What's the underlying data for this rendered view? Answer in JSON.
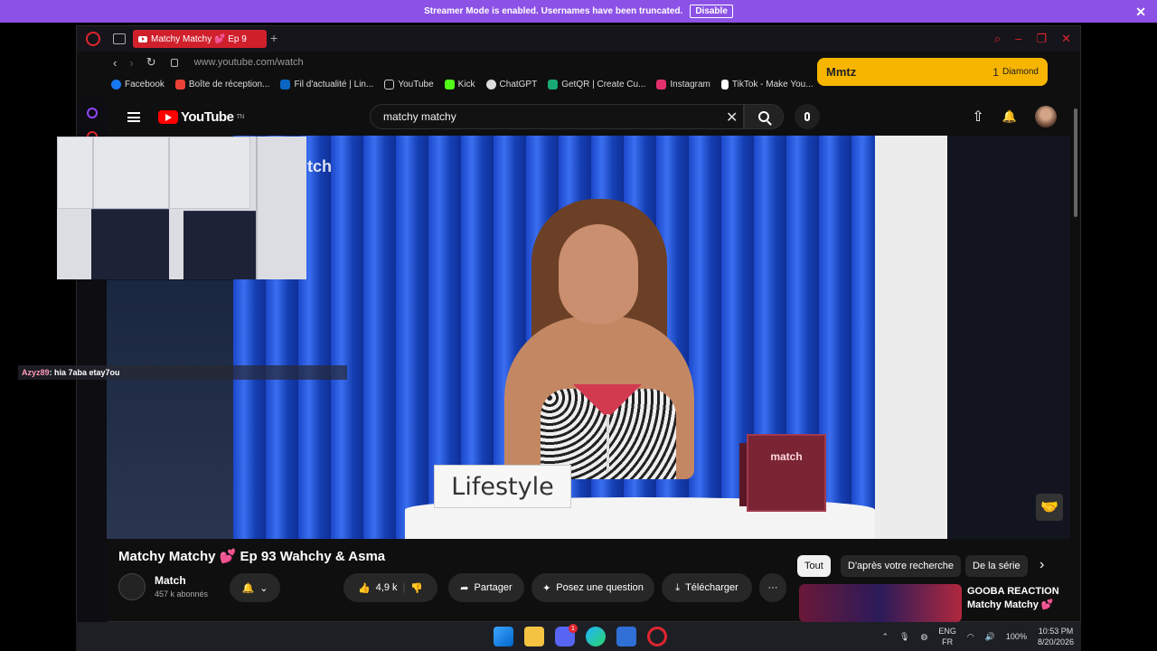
{
  "banner": {
    "message": "Streamer Mode is enabled. Usernames have been truncated.",
    "disable_label": "Disable",
    "close": "✕"
  },
  "browser": {
    "tab_title": "Matchy Matchy 💕 Ep 9",
    "new_tab": "+",
    "url": "www.youtube.com/watch",
    "nav_back": "‹",
    "nav_forward": "›",
    "reload": "↻",
    "bookmarks": [
      {
        "label": "Facebook",
        "color": "#1877f2"
      },
      {
        "label": "Boîte de réception...",
        "color": "#ea4335"
      },
      {
        "label": "Fil d'actualité | Lin...",
        "color": "#0a66c2"
      },
      {
        "label": "YouTube",
        "color": "#cccccc"
      },
      {
        "label": "Kick",
        "color": "#53fc18"
      },
      {
        "label": "ChatGPT",
        "color": "#dddddd"
      },
      {
        "label": "GetQR | Create Cu...",
        "color": "#19a974"
      },
      {
        "label": "Instagram",
        "color": "#e1306c"
      },
      {
        "label": "TikTok - Make You...",
        "color": "#ffffff"
      }
    ]
  },
  "youtube": {
    "logo_text": "YouTube",
    "logo_sup": "TN",
    "search_value": "matchy matchy",
    "clear": "✕",
    "upload": "⇧",
    "bell": "🔔"
  },
  "video": {
    "watermark": "tch",
    "sign_text": "Lifestyle",
    "box_text": "match",
    "title": "Matchy Matchy 💕 Ep 93 Wahchy & Asma",
    "channel": "Match",
    "subscribers": "457 k abonnés",
    "likes": "4,9 k",
    "share": "Partager",
    "ask": "Posez une question",
    "download": "Télécharger",
    "more": "···"
  },
  "chips": {
    "items": [
      "Tout",
      "D'après votre recherche",
      "De la série"
    ],
    "next": "›"
  },
  "suggestion": {
    "line1": "GOOBA REACTION",
    "line2": "Matchy Matchy 💕"
  },
  "overlay": {
    "chat_user": "Azyz89",
    "chat_msg": " : hia 7aba etay7ou",
    "donor_name": "Mmtz",
    "donor_amount": "1",
    "donor_unit": "Diamond"
  },
  "taskbar": {
    "lang_top": "ENG",
    "lang_bottom": "FR",
    "battery": "100%",
    "time": "10:53 PM",
    "date": "8/20/2026",
    "badge": "1"
  },
  "colors": {
    "banner": "#8c52e6",
    "opera_red": "#e0252f",
    "donor": "#f7b500"
  }
}
